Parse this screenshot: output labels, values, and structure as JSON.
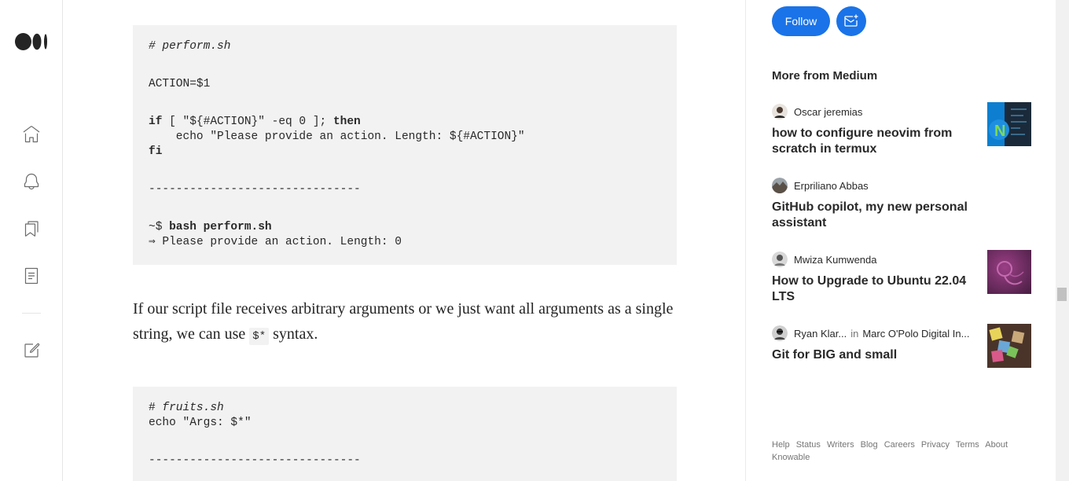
{
  "nav": {
    "logo": "medium-logo",
    "items": [
      "home-icon",
      "notifications-icon",
      "lists-icon",
      "stories-icon",
      "write-icon"
    ]
  },
  "code_block_1": {
    "lines": [
      {
        "text": "# perform.sh",
        "style": "comment"
      },
      {
        "text": "ACTION=$1"
      },
      {
        "kw": "if",
        "rest": " [ \"${#ACTION}\" -eq 0 ]; ",
        "kw2": "then"
      },
      {
        "text": "    echo \"Please provide an action. Length: ${#ACTION}\""
      },
      {
        "kw": "fi"
      },
      {
        "text": "-------------------------------"
      },
      {
        "text": "~$ ",
        "kw2": "bash perform.sh"
      },
      {
        "text": "⇒ Please provide an action. Length: 0"
      }
    ]
  },
  "paragraph": {
    "before": "If our script file receives arbitrary arguments or we just want all arguments as a single string, we can use ",
    "code": "$*",
    "after": " syntax."
  },
  "code_block_2": {
    "line1_hash": "# ",
    "line1_comment": "fruits.sh",
    "line2": "echo \"Args: $*\"",
    "line3": "-------------------------------"
  },
  "sidebar": {
    "follow_label": "Follow",
    "subscribe_icon": "mail-plus-icon",
    "more_heading": "More from Medium",
    "recommendations": [
      {
        "author": "Oscar jeremias",
        "title": "how to configure neovim from scratch in termux",
        "publication": "",
        "thumb_color": "#1a2a3a"
      },
      {
        "author": "Erpriliano Abbas",
        "title": "GitHub copilot, my new personal assistant",
        "publication": ""
      },
      {
        "author": "Mwiza Kumwenda",
        "title": "How to Upgrade to Ubuntu 22.04 LTS",
        "publication": "",
        "thumb_color": "#6b2b5e"
      },
      {
        "author": "Ryan Klar...",
        "in_label": "in",
        "publication": "Marc O'Polo Digital In...",
        "title": "Git for BIG and small",
        "thumb_color": "#5a3a2a"
      }
    ],
    "footer_links": [
      "Help",
      "Status",
      "Writers",
      "Blog",
      "Careers",
      "Privacy",
      "Terms",
      "About",
      "Knowable"
    ]
  }
}
